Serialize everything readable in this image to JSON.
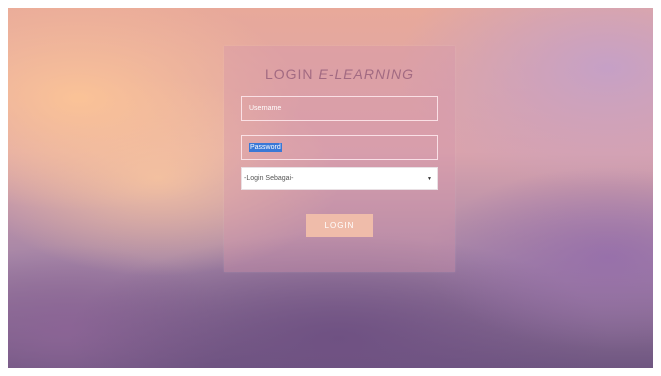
{
  "login_form": {
    "title_prefix": "LOGIN ",
    "title_emphasis": "E-LEARNING",
    "username_placeholder": "Username",
    "password_placeholder": "Password",
    "role_select_value": "-Login Sebagai-",
    "submit_label": "LOGIN"
  },
  "colors": {
    "title": "#a26a82",
    "button": "#efbcaa",
    "selection_highlight": "#3a78d6"
  },
  "icons": {
    "select_arrow": "dropdown-arrow-icon"
  }
}
